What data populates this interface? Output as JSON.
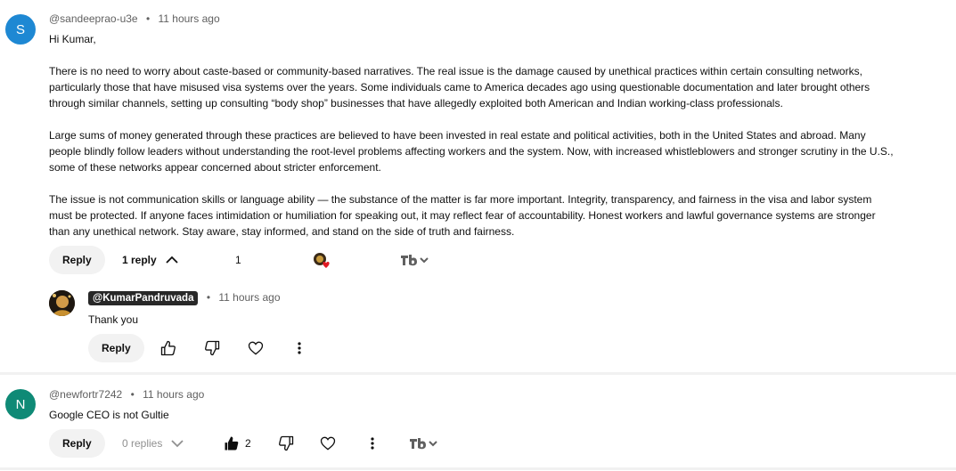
{
  "comments": [
    {
      "avatar_letter": "S",
      "avatar_color": "#1e88d3",
      "handle": "@sandeeprao-u3e",
      "time": "11 hours ago",
      "greeting": "Hi Kumar,",
      "paragraphs": [
        "There is no need to worry about caste-based or community-based narratives. The real issue is the damage caused by unethical practices within certain consulting networks, particularly those that have misused visa systems over the years. Some individuals came to America decades ago using questionable documentation and later brought others through similar channels, setting up consulting “body shop” businesses that have allegedly exploited both American and Indian working-class professionals.",
        "Large sums of money generated through these practices are believed to have been invested in real estate and political activities, both in the United States and abroad. Many people blindly follow leaders without understanding the root-level problems affecting workers and the system. Now, with increased whistleblowers and stronger scrutiny in the U.S., some of these networks appear concerned about stricter enforcement.",
        "The issue is not communication skills or language ability — the substance of the matter is far more important. Integrity, transparency, and fairness in the visa and labor system must be protected. If anyone faces intimidation or humiliation for speaking out, it may reflect fear of accountability. Honest workers and lawful governance systems are stronger than any unethical network. Stay aware, stay informed, and stand on the side of truth and fairness."
      ],
      "reply_label": "Reply",
      "replies_label": "1 reply",
      "like_count": "1"
    },
    {
      "handle": "@KumarPandruvada",
      "time": "11 hours ago",
      "text": "Thank you",
      "reply_label": "Reply"
    },
    {
      "avatar_letter": "N",
      "avatar_color": "#0f8a76",
      "handle": "@newfortr7242",
      "time": "11 hours ago",
      "text": "Google CEO is not Gultie",
      "reply_label": "Reply",
      "replies_label": "0 replies",
      "like_count": "2"
    }
  ],
  "separator": "•",
  "icons": {
    "like": "thumbs-up-icon",
    "dislike": "thumbs-down-icon",
    "heart": "heart-icon",
    "more": "more-vertical-icon",
    "chevron_up": "chevron-up-icon",
    "chevron_down": "chevron-down-icon",
    "tube_buddy": "tubebuddy-icon",
    "creator_heart": "creator-heart-icon"
  }
}
